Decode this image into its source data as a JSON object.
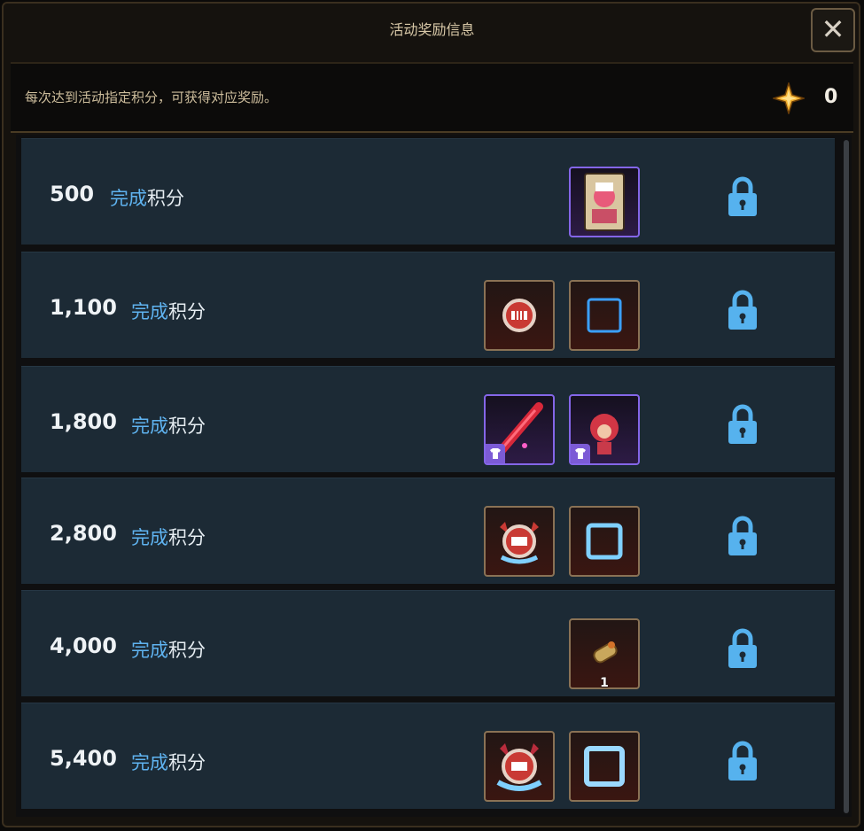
{
  "header": {
    "title": "活动奖励信息"
  },
  "info": {
    "description": "每次达到活动指定积分，可获得对应奖励。",
    "points": "0"
  },
  "colors": {
    "accent_blue": "#5fb3f0",
    "lock_blue": "#56b2ee",
    "gold_star": "#f3b02e",
    "row_bg": "#1c2a35"
  },
  "rows": [
    {
      "score": "500",
      "status": "完成",
      "suffix": "积分",
      "rewards": [
        {
          "icon": "character-card-icon",
          "rarity": "purple",
          "badge": false,
          "qty": ""
        }
      ]
    },
    {
      "score": "1,100",
      "status": "完成",
      "suffix": "积分",
      "rewards": [
        {
          "icon": "badge-iii-icon",
          "rarity": "brown",
          "badge": false,
          "qty": ""
        },
        {
          "icon": "blue-frame-icon",
          "rarity": "brown",
          "badge": false,
          "qty": ""
        }
      ]
    },
    {
      "score": "1,800",
      "status": "完成",
      "suffix": "积分",
      "rewards": [
        {
          "icon": "firework-weapon-icon",
          "rarity": "purple",
          "badge": true,
          "qty": ""
        },
        {
          "icon": "character-costume-icon",
          "rarity": "purple",
          "badge": true,
          "qty": ""
        }
      ]
    },
    {
      "score": "2,800",
      "status": "完成",
      "suffix": "积分",
      "rewards": [
        {
          "icon": "badge-iii-winged-icon",
          "rarity": "brown",
          "badge": false,
          "qty": ""
        },
        {
          "icon": "ice-frame-icon",
          "rarity": "brown",
          "badge": false,
          "qty": ""
        }
      ]
    },
    {
      "score": "4,000",
      "status": "完成",
      "suffix": "积分",
      "rewards": [
        {
          "icon": "scroll-item-icon",
          "rarity": "brown",
          "badge": false,
          "qty": "1"
        }
      ]
    },
    {
      "score": "5,400",
      "status": "完成",
      "suffix": "积分",
      "rewards": [
        {
          "icon": "badge-iii-horned-icon",
          "rarity": "brown",
          "badge": false,
          "qty": ""
        },
        {
          "icon": "ice-frame-large-icon",
          "rarity": "brown",
          "badge": false,
          "qty": ""
        }
      ]
    }
  ]
}
